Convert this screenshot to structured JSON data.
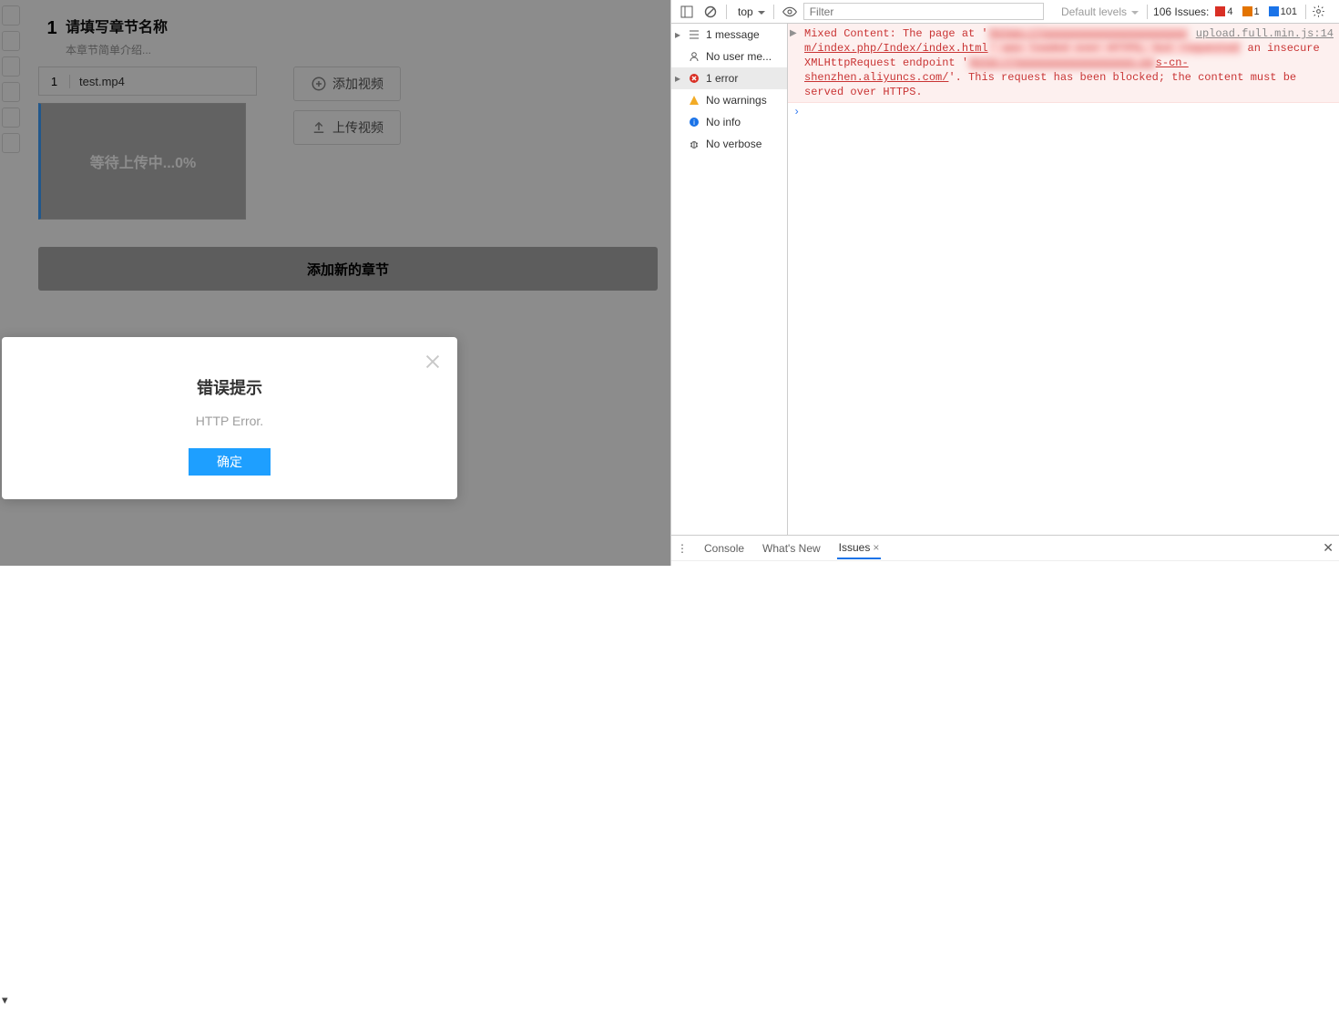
{
  "app": {
    "chapter": {
      "number": "1",
      "title_placeholder": "请填写章节名称",
      "subtitle_placeholder": "本章节简单介绍..."
    },
    "video": {
      "index": "1",
      "filename": "test.mp4",
      "upload_status": "等待上传中...0%"
    },
    "buttons": {
      "add_video": "添加视频",
      "upload_video": "上传视频",
      "add_chapter": "添加新的章节"
    },
    "sidebar_plus": "+",
    "sidebar_select": "▾"
  },
  "modal": {
    "title": "错误提示",
    "message": "HTTP Error.",
    "ok": "确定"
  },
  "devtools": {
    "toolbar": {
      "context": "top",
      "filter_placeholder": "Filter",
      "levels": "Default levels",
      "issues_label": "106 Issues:",
      "badge_err": "4",
      "badge_warn": "1",
      "badge_info": "101"
    },
    "sidebar": {
      "messages": "1 message",
      "usermsg": "No user me...",
      "errors": "1 error",
      "warnings": "No warnings",
      "info": "No info",
      "verbose": "No verbose"
    },
    "console": {
      "source_link": "upload.full.min.js:14",
      "pre1": "Mixed Content: The page at '",
      "blur1": "https://xxxxxxxxxxxxxxxxxxxxxx",
      "mid1": "m/index.php/Index/index.html",
      "blur2": "' was loaded over HTTPS, but requested",
      "post1": " an insecure XMLHttpRequest endpoint '",
      "blur3": "http://xxxxxxxxxxxxxxxxxx.os",
      "tail1": "s-cn-shenzhen.aliyuncs.com/",
      "post2": "'. This request has been blocked; the content must be served over HTTPS.",
      "prompt": "›"
    },
    "drawer": {
      "kebab": "⋮",
      "tab_console": "Console",
      "tab_whatsnew": "What's New",
      "tab_issues": "Issues",
      "close": "✕"
    }
  }
}
